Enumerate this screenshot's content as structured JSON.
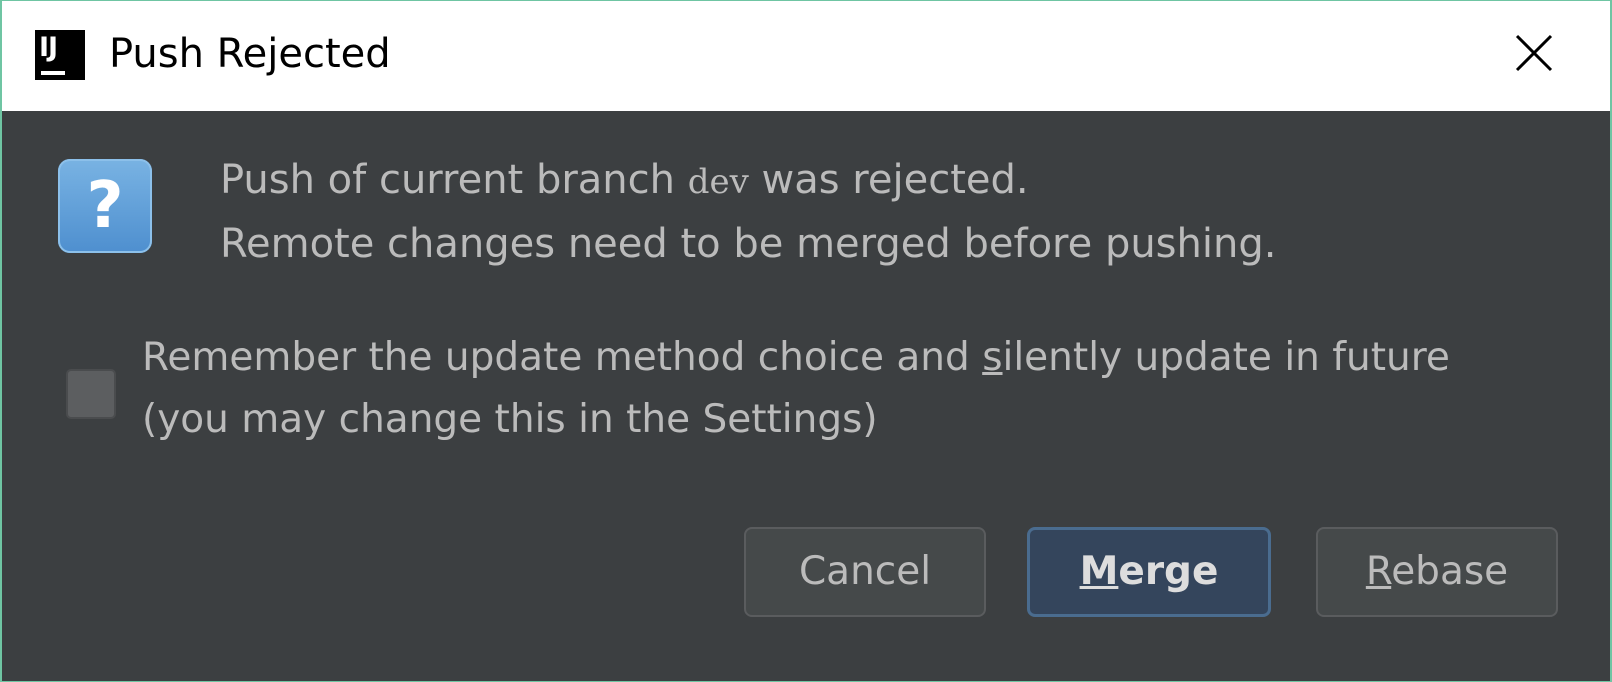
{
  "window": {
    "title": "Push Rejected",
    "app_icon_text": "IJ"
  },
  "message": {
    "line1_prefix": "Push of current branch ",
    "branch": "dev",
    "line1_suffix": " was rejected.",
    "line2": "Remote changes need to be merged before pushing."
  },
  "remember": {
    "checked": false,
    "line1_pre": "Remember the update method choice and ",
    "line1_mnemonic": "s",
    "line1_post": "ilently update in future",
    "line2": "(you may change this in the Settings)"
  },
  "buttons": {
    "cancel": "Cancel",
    "merge_mnemonic": "M",
    "merge_rest": "erge",
    "rebase_mnemonic": "R",
    "rebase_rest": "ebase"
  },
  "icons": {
    "app": "intellij-icon",
    "close": "close-icon",
    "dialog": "question-icon"
  },
  "colors": {
    "dialog_background": "#3c3f41",
    "text": "#bbbbbb",
    "default_button": "#34455c",
    "window_border": "#6fc5a3"
  }
}
